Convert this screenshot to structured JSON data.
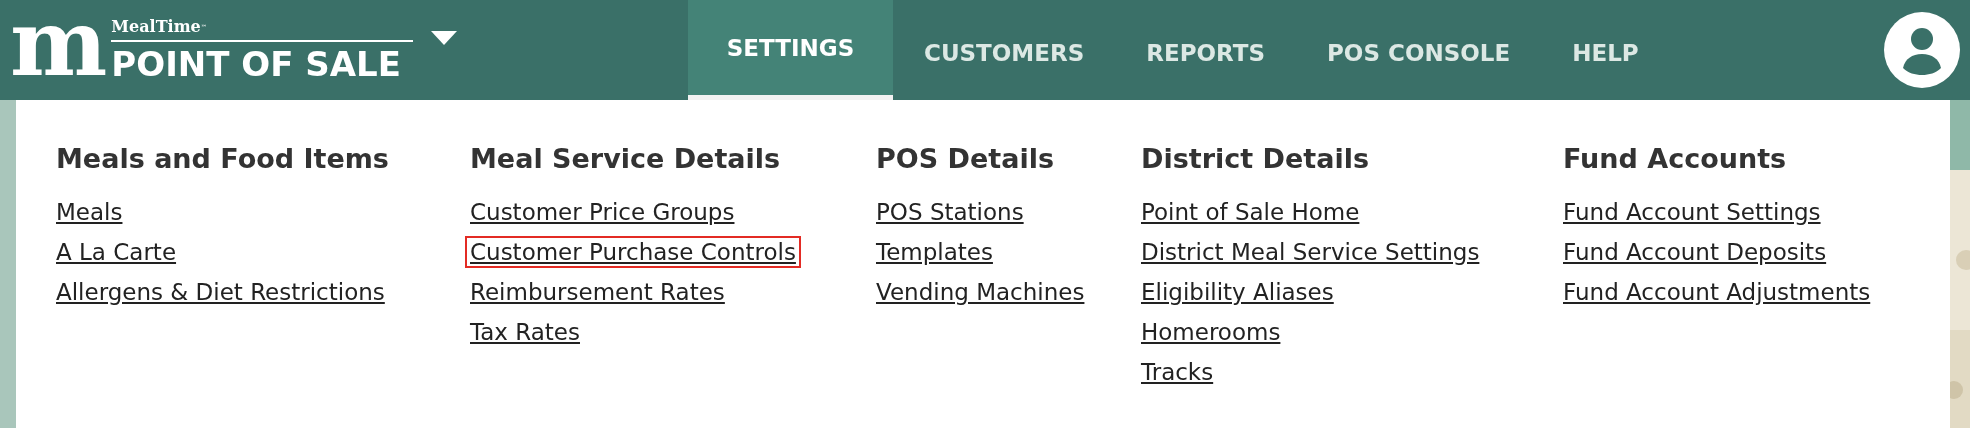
{
  "header": {
    "logo_mark": "m",
    "brand": "MealTime",
    "brand_mark": "™",
    "product": "POINT OF SALE"
  },
  "nav": [
    {
      "label": "SETTINGS",
      "selected": true
    },
    {
      "label": "CUSTOMERS",
      "selected": false
    },
    {
      "label": "REPORTS",
      "selected": false
    },
    {
      "label": "POS CONSOLE",
      "selected": false
    },
    {
      "label": "HELP",
      "selected": false
    }
  ],
  "menu": [
    {
      "heading": "Meals and Food Items",
      "items": [
        {
          "label": "Meals",
          "highlighted": false
        },
        {
          "label": "A La Carte",
          "highlighted": false
        },
        {
          "label": "Allergens & Diet Restrictions",
          "highlighted": false
        }
      ]
    },
    {
      "heading": "Meal Service Details",
      "items": [
        {
          "label": "Customer Price Groups",
          "highlighted": false
        },
        {
          "label": "Customer Purchase Controls",
          "highlighted": true
        },
        {
          "label": "Reimbursement Rates",
          "highlighted": false
        },
        {
          "label": "Tax Rates",
          "highlighted": false
        }
      ]
    },
    {
      "heading": "POS Details",
      "items": [
        {
          "label": "POS Stations",
          "highlighted": false
        },
        {
          "label": "Templates",
          "highlighted": false
        },
        {
          "label": "Vending Machines",
          "highlighted": false
        }
      ]
    },
    {
      "heading": "District Details",
      "items": [
        {
          "label": "Point of Sale Home",
          "highlighted": false
        },
        {
          "label": "District Meal Service Settings",
          "highlighted": false
        },
        {
          "label": "Eligibility Aliases",
          "highlighted": false
        },
        {
          "label": "Homerooms",
          "highlighted": false
        },
        {
          "label": "Tracks",
          "highlighted": false
        }
      ]
    },
    {
      "heading": "Fund Accounts",
      "items": [
        {
          "label": "Fund Account Settings",
          "highlighted": false
        },
        {
          "label": "Fund Account Deposits",
          "highlighted": false
        },
        {
          "label": "Fund Account Adjustments",
          "highlighted": false
        }
      ]
    }
  ]
}
